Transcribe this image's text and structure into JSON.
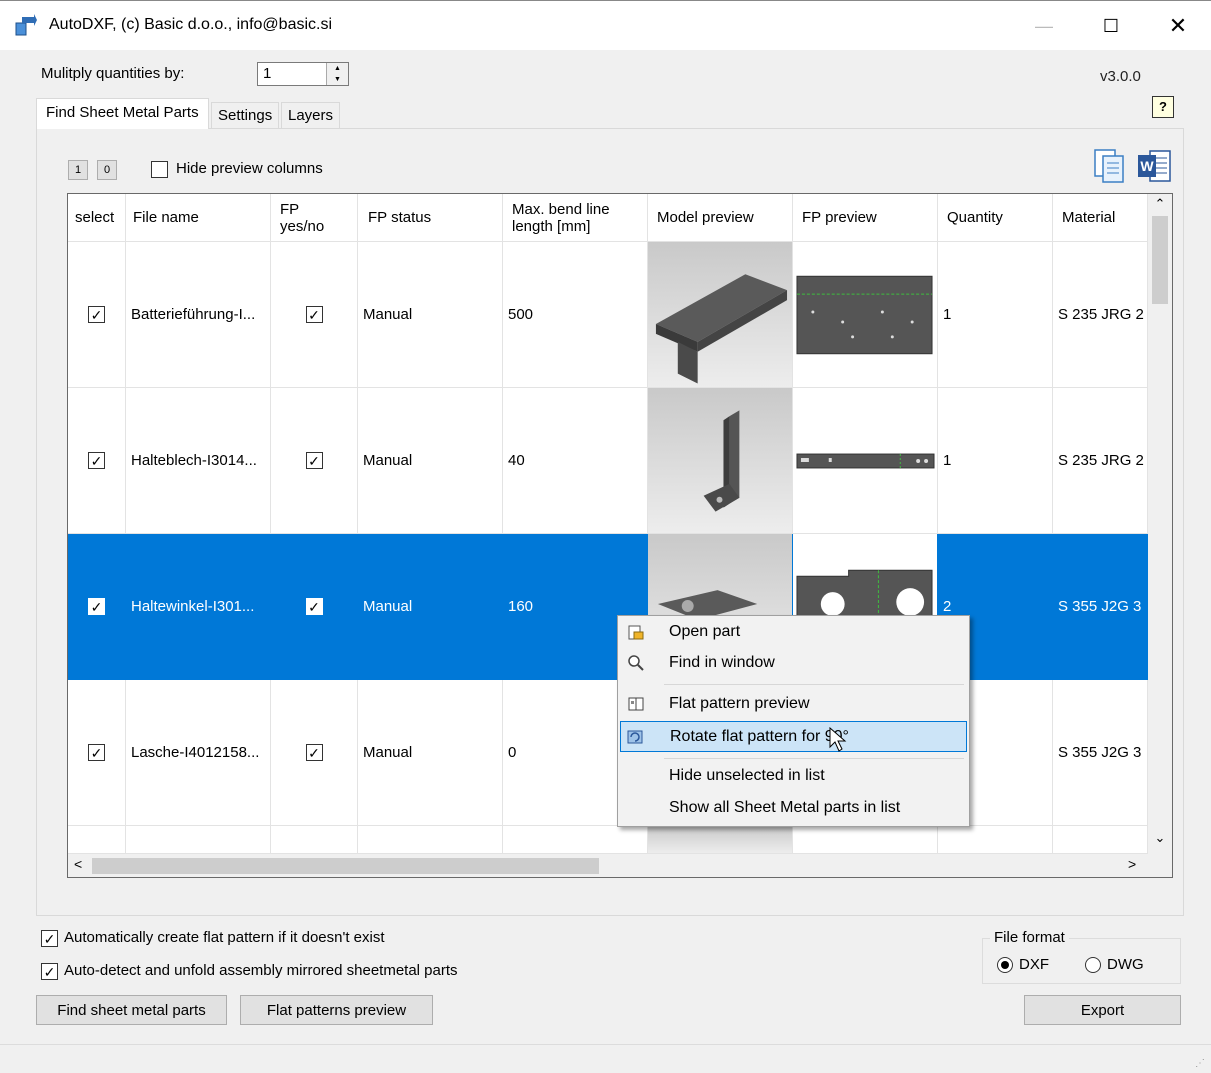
{
  "window": {
    "title": "AutoDXF, (c) Basic d.o.o., info@basic.si",
    "minimize_symbol": "—",
    "maximize_symbol": "☐",
    "close_symbol": "✕"
  },
  "multiply": {
    "label": "Mulitply quantities by:",
    "value": "1"
  },
  "version": "v3.0.0",
  "help_symbol": "?",
  "tabs": [
    "Find Sheet Metal Parts",
    "Settings",
    "Layers"
  ],
  "toolbar": {
    "one_label": "1",
    "zero_label": "0",
    "hide_preview_label": "Hide preview columns",
    "hide_preview_checked": false,
    "copy_icon": "copy-icon",
    "word_icon": "word-export-icon"
  },
  "columns": [
    "select",
    "File name",
    "FP yes/no",
    "FP status",
    "Max. bend line length [mm]",
    "Model preview",
    "FP preview",
    "Quantity",
    "Material"
  ],
  "column_headers": {
    "select": "select",
    "file_name": "File name",
    "fp_line1": "FP",
    "fp_line2": "yes/no",
    "fp_status": "FP status",
    "bend_line1": "Max. bend line",
    "bend_line2": "length [mm]",
    "model_preview": "Model preview",
    "fp_preview": "FP preview",
    "quantity": "Quantity",
    "material": "Material"
  },
  "rows": [
    {
      "select": true,
      "file_name": "Batterieführung-I...",
      "fp": true,
      "fp_status": "Manual",
      "bend": "500",
      "quantity": "1",
      "material": "S 235 JRG 2",
      "selected": false
    },
    {
      "select": true,
      "file_name": "Halteblech-I3014...",
      "fp": true,
      "fp_status": "Manual",
      "bend": "40",
      "quantity": "1",
      "material": "S 235 JRG 2",
      "selected": false
    },
    {
      "select": true,
      "file_name": "Haltewinkel-I301...",
      "fp": true,
      "fp_status": "Manual",
      "bend": "160",
      "quantity": "2",
      "material": "S 355 J2G 3",
      "selected": true
    },
    {
      "select": true,
      "file_name": "Lasche-I4012158...",
      "fp": true,
      "fp_status": "Manual",
      "bend": "0",
      "quantity": "",
      "material": "S 355 J2G 3",
      "selected": false
    }
  ],
  "check_mark": "✓",
  "scroll_symbols": {
    "up": "⌃",
    "down": "⌄",
    "left": "<",
    "right": ">"
  },
  "context_menu": {
    "items": [
      {
        "label": "Open part",
        "icon": "open-part-icon"
      },
      {
        "label": "Find in window",
        "icon": "find-in-window-icon"
      },
      {
        "label": "Flat pattern preview",
        "icon": "flat-pattern-preview-icon"
      },
      {
        "label": "Rotate flat pattern for 90°",
        "icon": "rotate-flat-pattern-icon",
        "highlighted": true
      },
      {
        "label": "Hide unselected in list"
      },
      {
        "label": "Show all Sheet Metal parts in list"
      }
    ]
  },
  "options": {
    "auto_create_label": "Automatically create flat pattern if it doesn't exist",
    "auto_create_checked": true,
    "auto_detect_label": "Auto-detect and unfold assembly mirrored sheetmetal parts",
    "auto_detect_checked": true
  },
  "buttons": {
    "find": "Find sheet metal parts",
    "fp_preview": "Flat patterns preview",
    "export": "Export"
  },
  "file_format": {
    "label": "File format",
    "options": [
      "DXF",
      "DWG"
    ],
    "selected": "DXF"
  },
  "colors": {
    "selection": "#0078d7",
    "menu_highlight": "#cce4f7"
  }
}
